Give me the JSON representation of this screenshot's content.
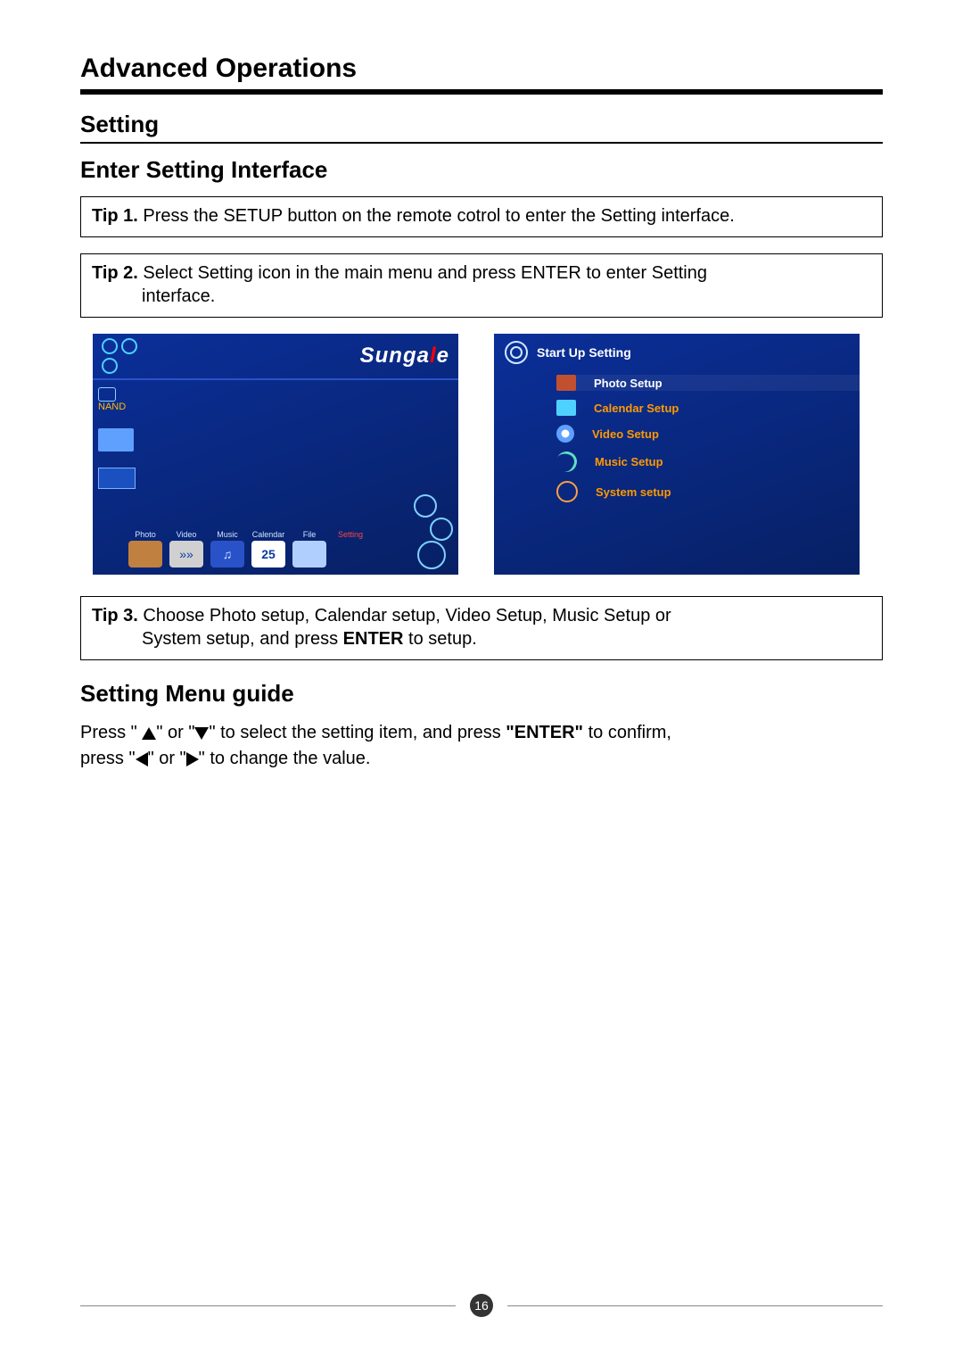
{
  "header": {
    "title": "Advanced Operations"
  },
  "setting": {
    "title": "Setting",
    "enter_title": "Enter Setting Interface",
    "tip1_label": "Tip 1.",
    "tip1_text": " Press the SETUP button on the remote cotrol to enter the Setting interface.",
    "tip2_label": "Tip 2.",
    "tip2_text": " Select Setting icon in the main menu and press ENTER to enter Setting",
    "tip2_text_line2": "interface.",
    "tip3_label": "Tip 3.",
    "tip3_text": " Choose Photo setup, Calendar setup, Video Setup, Music Setup or",
    "tip3_text_line2": "System setup, and press ",
    "tip3_bold": "ENTER",
    "tip3_text_tail": " to setup.",
    "menu_guide_title": "Setting Menu guide",
    "guide_p1_a": "Press \" ",
    "guide_p1_b": "\" or \"",
    "guide_p1_c": "\" to select the setting item, and press ",
    "guide_p1_enter": "\"ENTER\"",
    "guide_p1_d": " to confirm,",
    "guide_p2_a": "press \"",
    "guide_p2_b": "\" or \"",
    "guide_p2_c": "\" to change the value."
  },
  "screenshot_a": {
    "brand_pre": "Sunga",
    "brand_red": "l",
    "brand_post": "e",
    "nand_label": "NAND",
    "items": [
      "Photo",
      "Video",
      "Music",
      "Calendar",
      "File",
      "Setting"
    ],
    "cal_num": "25"
  },
  "screenshot_b": {
    "header": "Start Up Setting",
    "rows": [
      "Photo Setup",
      "Calendar Setup",
      "Video Setup",
      "Music Setup",
      "System setup"
    ]
  },
  "footer": {
    "page": "16"
  }
}
